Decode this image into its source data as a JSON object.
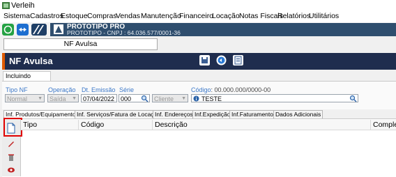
{
  "window": {
    "title": "Verleih"
  },
  "menu": [
    "Sistema",
    "Cadastros",
    "Estoque",
    "Compras",
    "Vendas",
    "Manutenção",
    "Financeiro",
    "Locação",
    "Notas Fiscais",
    "Relatórios",
    "Utilitários"
  ],
  "banner": {
    "name": "PROTOTIPO PRO",
    "subtitle": "PROTOTIPO - CNPJ : 64.036.577/0001-36"
  },
  "open_tab": "NF Avulsa",
  "header": {
    "title": "NF Avulsa"
  },
  "sub_tab": "Incluindo Registro",
  "form": {
    "tipo_nf": {
      "label": "Tipo NF",
      "value": "Normal"
    },
    "operacao": {
      "label": "Operação",
      "value": "Saída"
    },
    "dt_emissao": {
      "label": "Dt. Emissão",
      "value": "07/04/2022"
    },
    "serie": {
      "label": "Série",
      "value": "000"
    },
    "cliente": {
      "placeholder": "Cliente"
    },
    "codigo": {
      "label": "Código",
      "mask": ": 00.000.000/0000-00",
      "value": "TESTE"
    }
  },
  "tabs": [
    "Inf. Produtos/Equipamentos",
    "Inf. Serviços/Fatura de Locação",
    "Inf. Endereços",
    "Inf.Expedição",
    "Inf.Faturamento",
    "Dados Adicionais"
  ],
  "grid": {
    "columns": [
      "Tipo",
      "Código",
      "Descrição",
      "Complemento"
    ]
  },
  "colors": {
    "header_bg": "#1f2d4e",
    "accent": "#e05a00",
    "highlight": "#e00000",
    "banner_bg": "#2f4e6e"
  }
}
